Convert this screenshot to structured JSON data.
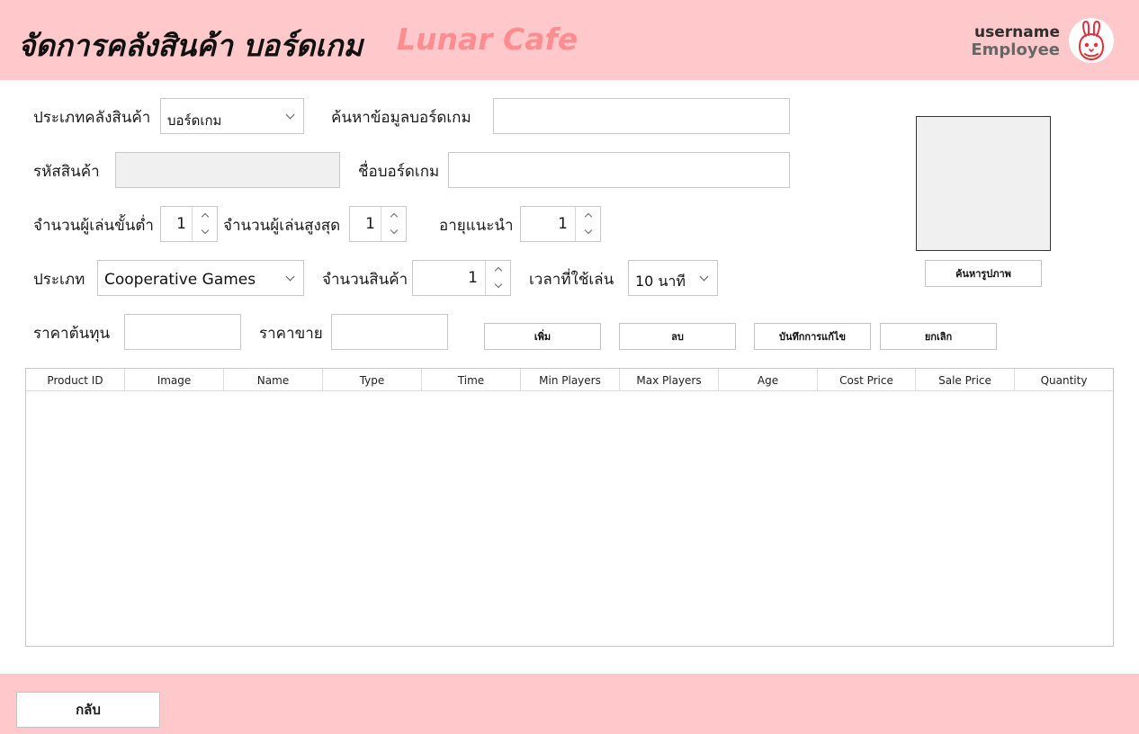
{
  "header": {
    "title": "จัดการคลังสินค้า บอร์ดเกม",
    "brand": "Lunar Cafe",
    "username": "username",
    "role": "Employee",
    "avatar_icon": "bunny-icon",
    "colors": {
      "bar": "#ffc9cb",
      "brand": "#ff8d90",
      "avatar_accent": "#e0303a"
    }
  },
  "form": {
    "inventory_type": {
      "label": "ประเภทคลังสินค้า",
      "value": "บอร์ดเกม"
    },
    "search": {
      "label": "ค้นหาข้อมูลบอร์ดเกม",
      "value": ""
    },
    "product_code": {
      "label": "รหัสสินค้า",
      "value": ""
    },
    "game_name": {
      "label": "ชื่อบอร์ดเกม",
      "value": ""
    },
    "min_players": {
      "label": "จำนวนผู้เล่นขั้นต่ำ",
      "value": "1"
    },
    "max_players": {
      "label": "จำนวนผู้เล่นสูงสุด",
      "value": "1"
    },
    "recommended_age": {
      "label": "อายุแนะนำ",
      "value": "1"
    },
    "category": {
      "label": "ประเภท",
      "value": "Cooperative Games"
    },
    "quantity": {
      "label": "จำนวนสินค้า",
      "value": "1"
    },
    "play_time": {
      "label": "เวลาที่ใช้เล่น",
      "value": "10 นาที"
    },
    "cost_price": {
      "label": "ราคาต้นทุน",
      "value": ""
    },
    "sale_price": {
      "label": "ราคาขาย",
      "value": ""
    }
  },
  "actions": {
    "search_image": "ค้นหารูปภาพ",
    "add": "เพิ่ม",
    "delete": "ลบ",
    "save_edit": "บันทึกการแก้ไข",
    "cancel": "ยกเลิก",
    "back": "กลับ"
  },
  "table": {
    "columns": [
      "Product ID",
      "Image",
      "Name",
      "Type",
      "Time",
      "Min Players",
      "Max Players",
      "Age",
      "Cost Price",
      "Sale Price",
      "Quantity"
    ],
    "rows": []
  }
}
